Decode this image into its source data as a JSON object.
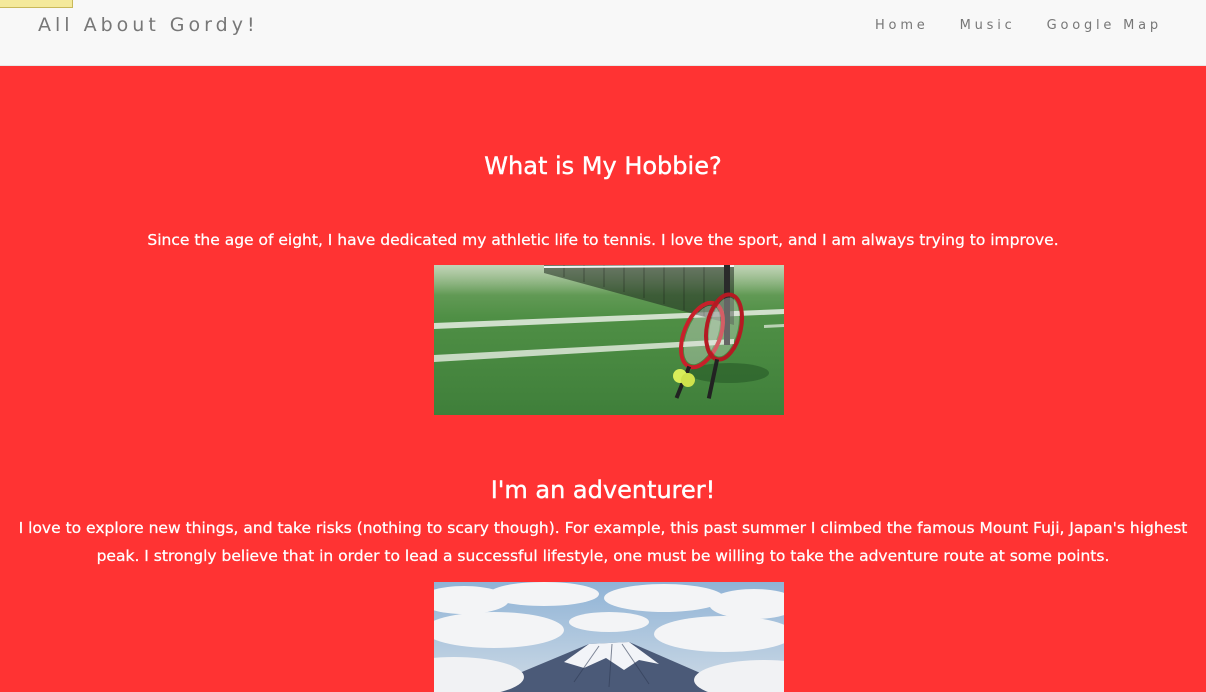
{
  "navbar": {
    "brand": "All About Gordy!",
    "links": [
      "Home",
      "Music",
      "Google Map"
    ]
  },
  "sections": [
    {
      "title": "What is My Hobbie?",
      "text": "Since the age of eight, I have dedicated my athletic life to tennis. I love the sport, and I am always trying to improve.",
      "image": "tennis racket and balls on green court photo"
    },
    {
      "title": "I'm an adventurer!",
      "text_line1": "I love to explore new things, and take risks (nothing to scary though). For example, this past summer I climbed the famous Mount Fuji, Japan's highest",
      "text_line2": "peak. I strongly believe that in order to lead a successful lifestyle, one must be willing to take the adventure route at some points.",
      "image": "Mount Fuji above clouds photo"
    }
  ],
  "colors": {
    "page_background": "#ff3333",
    "navbar_background": "#f8f8f8",
    "nav_text": "#777777",
    "content_text": "#ffffff"
  }
}
